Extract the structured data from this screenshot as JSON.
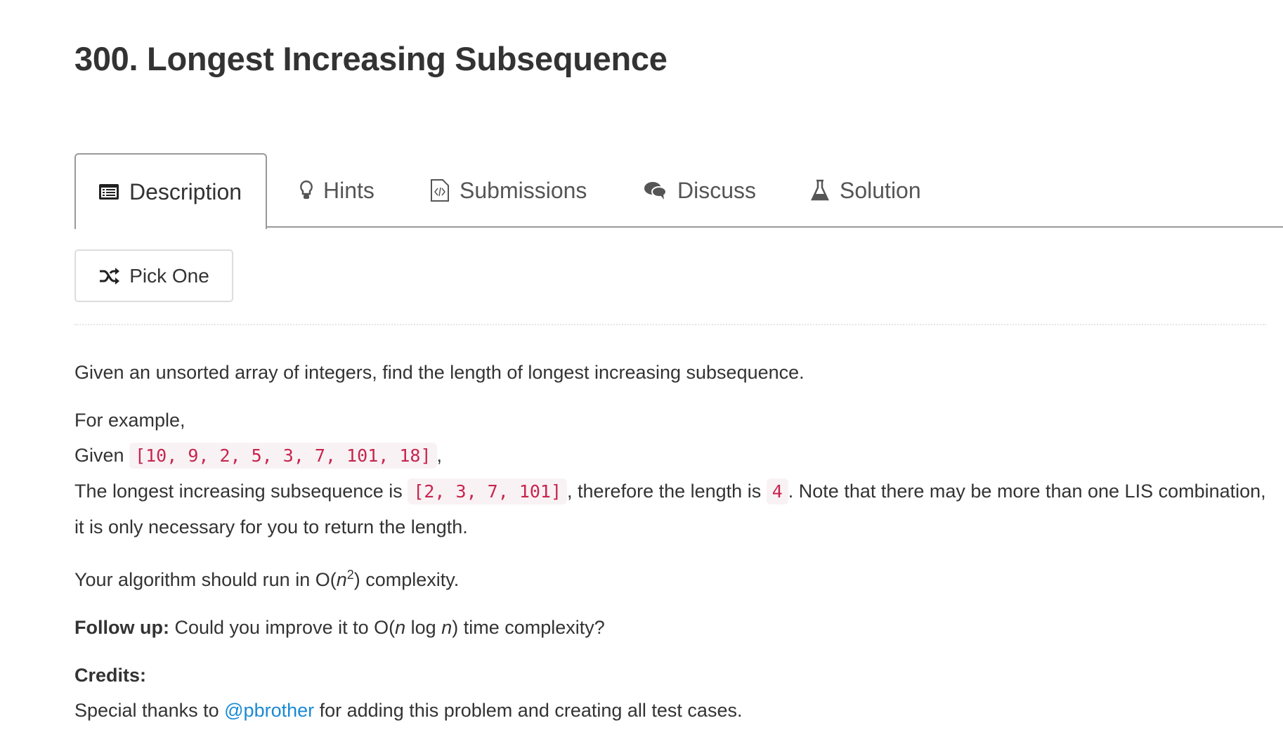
{
  "problem": {
    "title": "300. Longest Increasing Subsequence"
  },
  "tabs": [
    {
      "label": "Description",
      "icon": "list-icon",
      "active": true
    },
    {
      "label": "Hints",
      "icon": "lightbulb-icon"
    },
    {
      "label": "Submissions",
      "icon": "code-file-icon"
    },
    {
      "label": "Discuss",
      "icon": "comments-icon"
    },
    {
      "label": "Solution",
      "icon": "flask-icon"
    }
  ],
  "pick_one": {
    "label": "Pick One",
    "icon": "shuffle-icon"
  },
  "description": {
    "intro": "Given an unsorted array of integers, find the length of longest increasing subsequence.",
    "example_label": "For example,",
    "given_prefix": "Given",
    "given_array": "[10, 9, 2, 5, 3, 7, 101, 18]",
    "given_suffix": ",",
    "lis_prefix": "The longest increasing subsequence is",
    "lis_value": "[2, 3, 7, 101]",
    "lis_middle": ", therefore the length is",
    "lis_length": "4",
    "lis_suffix": ". Note that there may be more than one LIS combination, it is only necessary for you to return the length.",
    "complexity_prefix": "Your algorithm should run in O(",
    "complexity_var": "n",
    "complexity_exp": "2",
    "complexity_suffix": ") complexity.",
    "followup_label": "Follow up:",
    "followup_a": " Could you improve it to O(",
    "followup_n1": "n",
    "followup_b": " log ",
    "followup_n2": "n",
    "followup_c": ") time complexity?",
    "credits_label": "Credits:",
    "credits_prefix": "Special thanks to ",
    "credits_user": "@pbrother",
    "credits_suffix": " for adding this problem and creating all test cases."
  },
  "colors": {
    "code_text": "#c7254e",
    "code_bg": "#f9f2f4",
    "link": "#1a8ad4"
  }
}
